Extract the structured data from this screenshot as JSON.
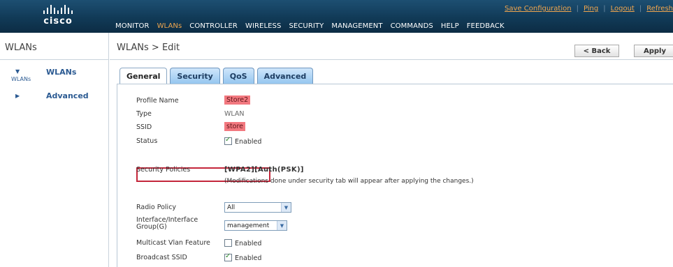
{
  "header": {
    "logo_text": "cisco",
    "util_links": [
      "Save Configuration",
      "Ping",
      "Logout",
      "Refresh"
    ],
    "nav": [
      {
        "label": "MONITOR",
        "active": false
      },
      {
        "label": "WLANs",
        "active": true
      },
      {
        "label": "CONTROLLER",
        "active": false
      },
      {
        "label": "WIRELESS",
        "active": false
      },
      {
        "label": "SECURITY",
        "active": false
      },
      {
        "label": "MANAGEMENT",
        "active": false
      },
      {
        "label": "COMMANDS",
        "active": false
      },
      {
        "label": "HELP",
        "active": false
      },
      {
        "label": "FEEDBACK",
        "active": false
      }
    ],
    "colors": {
      "bar": "#113a57",
      "accent": "#f0a64e"
    }
  },
  "sidebar": {
    "title": "WLANs",
    "items": [
      {
        "label": "WLANs",
        "expanded": true,
        "icon": "triangle-down-icon"
      },
      {
        "label": "Advanced",
        "expanded": false,
        "icon": "triangle-right-icon"
      }
    ],
    "sub_item": "WLANs"
  },
  "page": {
    "title": "WLANs > Edit",
    "back_label": "< Back",
    "apply_label": "Apply",
    "tabs": [
      {
        "label": "General",
        "active": true
      },
      {
        "label": "Security",
        "active": false
      },
      {
        "label": "QoS",
        "active": false
      },
      {
        "label": "Advanced",
        "active": false
      }
    ]
  },
  "form": {
    "profile_name": {
      "label": "Profile Name",
      "value": "Store2"
    },
    "type": {
      "label": "Type",
      "value": "WLAN"
    },
    "ssid": {
      "label": "SSID",
      "value": "store"
    },
    "status": {
      "label": "Status",
      "checked": true,
      "text": "Enabled"
    },
    "security_policies": {
      "label": "Security Policies",
      "value": "[WPA2][Auth(PSK)]",
      "note": "(Modifications done under security tab will appear after applying the changes.)"
    },
    "radio_policy": {
      "label": "Radio Policy",
      "value": "All"
    },
    "interface": {
      "label": "Interface/Interface Group(G)",
      "value": "management"
    },
    "multicast_vlan": {
      "label": "Multicast Vlan Feature",
      "checked": false,
      "text": "Enabled"
    },
    "broadcast_ssid": {
      "label": "Broadcast SSID",
      "checked": true,
      "text": "Enabled"
    }
  }
}
